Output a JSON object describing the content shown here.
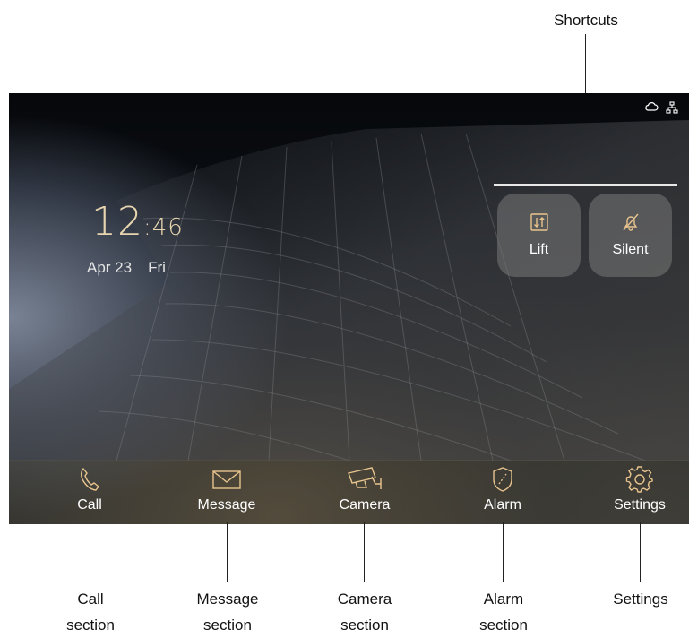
{
  "annotations": {
    "shortcuts": "Shortcuts",
    "call": [
      "Call",
      "section"
    ],
    "message": [
      "Message",
      "section"
    ],
    "camera": [
      "Camera",
      "section"
    ],
    "alarm": [
      "Alarm",
      "section"
    ],
    "settings": [
      "Settings"
    ]
  },
  "status_bar": {
    "icons": [
      "cloud-icon",
      "network-icon"
    ]
  },
  "clock": {
    "hours": "12",
    "separator": ":",
    "minutes": "46"
  },
  "date": {
    "day_month": "Apr 23",
    "weekday": "Fri"
  },
  "shortcuts": [
    {
      "label": "Lift",
      "icon": "lift-icon"
    },
    {
      "label": "Silent",
      "icon": "bell-off-icon"
    }
  ],
  "nav": [
    {
      "label": "Call",
      "icon": "phone-icon"
    },
    {
      "label": "Message",
      "icon": "envelope-icon"
    },
    {
      "label": "Camera",
      "icon": "cctv-camera-icon"
    },
    {
      "label": "Alarm",
      "icon": "shield-icon"
    },
    {
      "label": "Settings",
      "icon": "gear-icon"
    }
  ],
  "colors": {
    "accent_gold": "#e8c48e",
    "clock_text": "#e8d5b0",
    "label_text": "#ffffff"
  }
}
